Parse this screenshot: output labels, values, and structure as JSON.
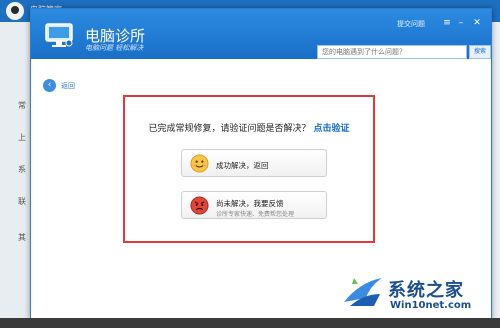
{
  "outer_window": {
    "title": "电脑管家",
    "sidebar_items": [
      "常",
      "上",
      "系",
      "联",
      "其"
    ]
  },
  "dialog": {
    "title": "电脑诊所",
    "subtitle": "电脑问题  轻松解决",
    "help_link": "提交问题",
    "search_placeholder": "您的电脑遇到了什么问题？",
    "search_button": "搜索",
    "back_label": "返回"
  },
  "verify_panel": {
    "question": "已完成常规修复，请验证问题是否解决？",
    "verify_link": "点击验证",
    "option_solved": {
      "label": "成功解决，返回"
    },
    "option_unsolved": {
      "label": "尚未解决，我要反馈",
      "sublabel": "诊所专家快速、免费帮您处理"
    }
  },
  "watermark": {
    "brand_text": "系统之家",
    "url": "Win10net.com"
  },
  "colors": {
    "titlebar": "#1d6fc0",
    "header_blue": "#1a6fc6",
    "highlight_box": "#e23a3a",
    "link": "#1a6fc6"
  }
}
